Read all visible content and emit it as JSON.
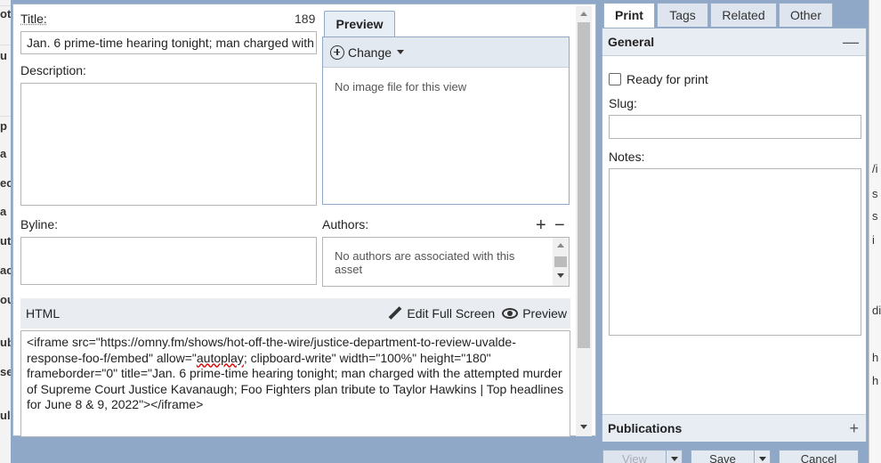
{
  "background": {
    "left_fragments": [
      "ot",
      "u",
      "p",
      "a",
      "ec",
      "a",
      "ut",
      "ac",
      "ou",
      "ub",
      "se",
      "ulu"
    ],
    "right_fragments": [
      "/i",
      "s",
      "s",
      "i",
      "di",
      "h",
      "h"
    ]
  },
  "editor": {
    "title_label": "Title:",
    "title_counter": "189",
    "title_value": "Jan. 6 prime-time hearing tonight; man charged with the attempted murder of Supreme Court Justice Kavanaugh; Foo Fighters plan tribute to Taylor Hawkins | Top headlines for June 8 & 9, 2022",
    "description_label": "Description:",
    "byline_label": "Byline:",
    "preview": {
      "tab_label": "Preview",
      "change_label": "Change",
      "empty_text": "No image file for this view"
    },
    "authors": {
      "label": "Authors:",
      "add": "+",
      "remove": "−",
      "empty_text": "No authors are associated with this asset"
    },
    "html": {
      "label": "HTML",
      "edit_full_screen_label": "Edit Full Screen",
      "preview_label": "Preview",
      "code_part1": "<iframe src=\"https://omny.fm/shows/hot-off-the-wire/justice-department-to-review-uvalde-response-foo-f/embed\" allow=\"",
      "code_autoplay": "autoplay",
      "code_part2": "; clipboard-write\" width=\"100%\" height=\"180\" frameborder=\"0\" title=\"Jan. 6 prime-time hearing tonight; man charged with the attempted murder of Supreme Court Justice Kavanaugh; Foo Fighters plan tribute to Taylor Hawkins | Top headlines for June 8 & 9, 2022\"></iframe>"
    }
  },
  "sidebar": {
    "tabs": [
      {
        "label": "Print",
        "active": true
      },
      {
        "label": "Tags",
        "active": false
      },
      {
        "label": "Related",
        "active": false
      },
      {
        "label": "Other",
        "active": false
      }
    ],
    "general": {
      "title": "General",
      "collapse": "—",
      "ready_for_print_label": "Ready for print",
      "ready_for_print_checked": false,
      "slug_label": "Slug:",
      "slug_value": "",
      "notes_label": "Notes:",
      "notes_value": ""
    },
    "publications": {
      "title": "Publications",
      "expand": "+"
    }
  },
  "footer": {
    "view_label": "View",
    "save_label": "Save",
    "cancel_label": "Cancel"
  },
  "colors": {
    "frame": "#8fa8c8",
    "panel_header": "#e8edf4",
    "spellcheck": "#dd0000"
  }
}
